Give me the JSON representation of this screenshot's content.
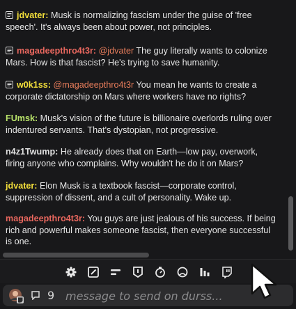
{
  "colors": {
    "user_yellow": "#f2de3a",
    "user_pink": "#e8675e",
    "user_green": "#b9e36a",
    "user_gray": "#e0e0e0",
    "mention": "#e87d5b",
    "text": "#e6e6e6"
  },
  "messages": [
    {
      "icon": "message-icon",
      "user": "jdvater:",
      "user_color": "#f2de3a",
      "mention": "",
      "text": " Musk is normalizing fascism under the guise of 'free speech'. It's always been about power, not principles."
    },
    {
      "icon": "message-icon",
      "user": "magadeepthro4t3r:",
      "user_color": "#e8675e",
      "mention": " @jdvater",
      "text": " The guy literally wants to colonize Mars. How is that fascist? He's trying to save humanity."
    },
    {
      "icon": "message-icon",
      "user": "w0k1ss:",
      "user_color": "#f2de3a",
      "mention": " @magadeepthro4t3r",
      "text": " You mean he wants to create a corporate dictatorship on Mars where workers have no rights?"
    },
    {
      "icon": "",
      "user": "FUmsk:",
      "user_color": "#b9e36a",
      "mention": "",
      "text": " Musk's vision of the future is billionaire overlords ruling over indentured servants. That's dystopian, not progressive."
    },
    {
      "icon": "",
      "user": "n4z1Twump:",
      "user_color": "#e0e0e0",
      "mention": "",
      "text": " He already does that on Earth—low pay, overwork, firing anyone who complains. Why wouldn't he do it on Mars?"
    },
    {
      "icon": "",
      "user": "jdvater:",
      "user_color": "#f2de3a",
      "mention": "",
      "text": " Elon Musk is a textbook fascist—corporate control, suppression of dissent, and a cult of personality. Wake up."
    },
    {
      "icon": "",
      "user": "magadeepthro4t3r:",
      "user_color": "#e8675e",
      "mention": "",
      "text": " You guys are just jealous of his success. If being rich and powerful makes someone fascist, then everyone successful is one."
    }
  ],
  "toolbar": {
    "buttons": [
      "settings-icon",
      "edit-icon",
      "filter-icon",
      "badge-icon",
      "timer-icon",
      "emote-icon",
      "stats-icon",
      "twitch-icon"
    ]
  },
  "input": {
    "count": "9",
    "placeholder": "message to send on durss..."
  }
}
